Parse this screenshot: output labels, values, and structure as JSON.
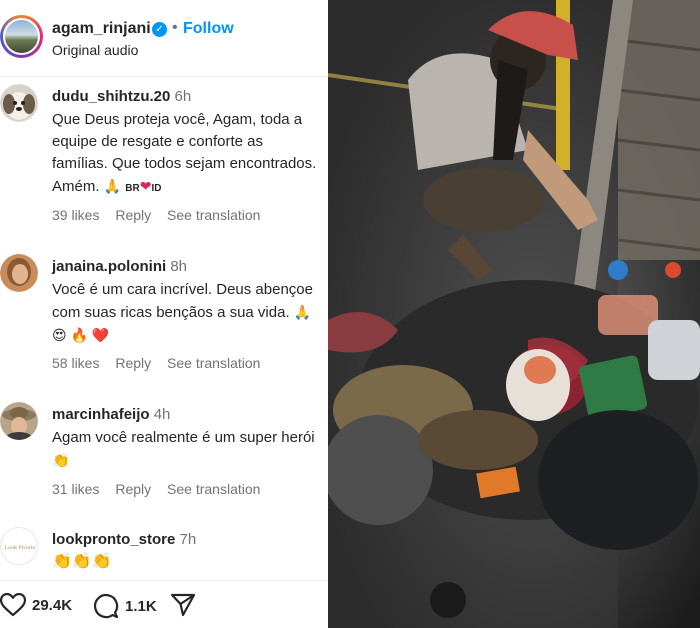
{
  "header": {
    "username": "agam_rinjani",
    "follow_label": "Follow",
    "separator": "•",
    "audio": "Original audio"
  },
  "comments": [
    {
      "username": "dudu_shihtzu.20",
      "time": "6h",
      "text": "Que Deus proteja você, Agam, toda a equipe de resgate e conforte as famílias. Que todos sejam encontrados. Amém.",
      "emoji": "🙏",
      "tags": [
        "BR",
        "ID"
      ],
      "tag_emoji": "❤",
      "likes": "39 likes",
      "reply": "Reply",
      "translate": "See translation"
    },
    {
      "username": "janaina.polonini",
      "time": "8h",
      "text": "Você é um cara incrível. Deus abençoe com suas ricas bençãos a sua vida.",
      "emoji": "🙏 😍 🔥 ❤️",
      "likes": "58 likes",
      "reply": "Reply",
      "translate": "See translation"
    },
    {
      "username": "marcinhafeijo",
      "time": "4h",
      "text": "Agam você realmente é um super herói",
      "emoji": "👏",
      "likes": "31 likes",
      "reply": "Reply",
      "translate": "See translation"
    },
    {
      "username": "lookpronto_store",
      "time": "7h",
      "emoji": "👏👏👏",
      "avatar_text": "Look Pronto"
    }
  ],
  "actions": {
    "likes_count": "29.4K",
    "comments_count": "1.1K"
  },
  "icons": {
    "verified": "verified-badge-icon",
    "heart": "heart-icon",
    "comment": "comment-icon",
    "share": "send-icon"
  },
  "colors": {
    "accent": "#0095f6",
    "muted": "#737373",
    "text": "#262626"
  }
}
